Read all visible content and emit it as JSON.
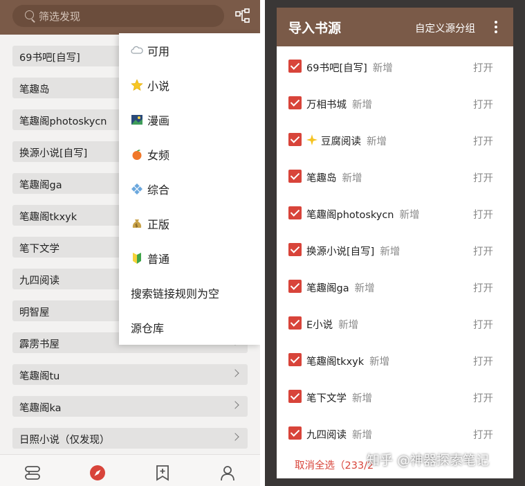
{
  "left": {
    "search": {
      "placeholder": "筛选发现"
    },
    "rows": [
      {
        "label": "69书吧[自写]"
      },
      {
        "label": "笔趣岛"
      },
      {
        "label": "笔趣阁photoskycn"
      },
      {
        "label": "换源小说[自写]"
      },
      {
        "label": "笔趣阁ga"
      },
      {
        "label": "笔趣阁tkxyk"
      },
      {
        "label": "笔下文学"
      },
      {
        "label": "九四阅读"
      },
      {
        "label": "明智屋"
      },
      {
        "label": "霹雳书屋"
      },
      {
        "label": "笔趣阁tu"
      },
      {
        "label": "笔趣阁ka"
      },
      {
        "label": "日照小说（仅发现）"
      }
    ],
    "dropdown": [
      {
        "label": "可用",
        "icon": "cloud-icon"
      },
      {
        "label": "小说",
        "icon": "star-icon"
      },
      {
        "label": "漫画",
        "icon": "picture-icon"
      },
      {
        "label": "女频",
        "icon": "peach-icon"
      },
      {
        "label": "综合",
        "icon": "diamond-icon"
      },
      {
        "label": "正版",
        "icon": "money-bag-icon"
      },
      {
        "label": "普通",
        "icon": "beginner-icon"
      },
      {
        "label": "搜索链接规则为空",
        "icon": ""
      },
      {
        "label": "源仓库",
        "icon": ""
      }
    ],
    "nav": [
      "bookshelf-icon",
      "explore-icon",
      "bookmark-icon",
      "profile-icon"
    ],
    "accent": "#7a5a48",
    "explore_color": "#d8443a"
  },
  "dialog": {
    "title": "导入书源",
    "group_button": "自定义源分组",
    "sources": [
      {
        "name": "69书吧[自写]",
        "badge": "新增",
        "action": "打开"
      },
      {
        "name": "万相书城",
        "badge": "新增",
        "action": "打开"
      },
      {
        "name": "豆腐阅读",
        "badge": "新增",
        "action": "打开",
        "icon": "sparkle-icon"
      },
      {
        "name": "笔趣岛",
        "badge": "新增",
        "action": "打开"
      },
      {
        "name": "笔趣阁photoskycn",
        "badge": "新增",
        "action": "打开"
      },
      {
        "name": "换源小说[自写]",
        "badge": "新增",
        "action": "打开"
      },
      {
        "name": "笔趣阁ga",
        "badge": "新增",
        "action": "打开"
      },
      {
        "name": "E小说",
        "badge": "新增",
        "action": "打开"
      },
      {
        "name": "笔趣阁tkxyk",
        "badge": "新增",
        "action": "打开"
      },
      {
        "name": "笔下文学",
        "badge": "新增",
        "action": "打开"
      },
      {
        "name": "九四阅读",
        "badge": "新增",
        "action": "打开"
      }
    ],
    "footer": "取消全选（233/2",
    "checkbox_color": "#d8443a"
  },
  "watermark": "知乎 @神器探索笔记"
}
